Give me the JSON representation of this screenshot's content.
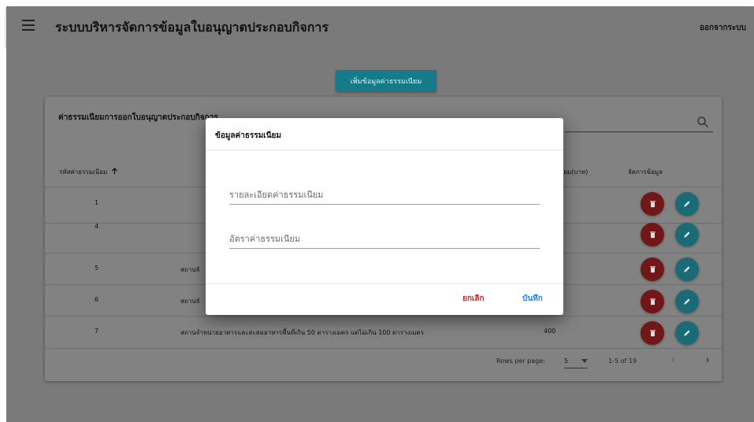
{
  "app": {
    "title": "ระบบบริหารจัดการข้อมูลใบอนุญาตประกอบกิจการ",
    "logout_label": "ออกจากระบบ"
  },
  "toolbar": {
    "add_label": "เพิ่มข้อมูลค่าธรรมเนียม"
  },
  "table": {
    "title": "ค่าธรรมเนียมการออกใบอนุญาตประกอบกิจการ",
    "columns": {
      "code": "รหัสค่าธรรมเนียม",
      "detail": "",
      "rate": "ค่าธรรมเนียม(บาท)",
      "rate_visible": "เนียม(บาท)",
      "actions": "จัดการข้อมูล"
    },
    "rows": [
      {
        "code": "1",
        "detail": "",
        "rate": ""
      },
      {
        "code": "4",
        "detail": "",
        "rate": ""
      },
      {
        "code": "5",
        "detail": "สถานจั",
        "rate": ""
      },
      {
        "code": "6",
        "detail": "สถานจั",
        "rate": ""
      },
      {
        "code": "7",
        "detail": "สถานจำหน่ายอาหารและสะสมอาหารพื้นที่เกิน 50 ตารางเมตร แต่ไม่เกิน 100 ตารางเมตร",
        "rate": "400"
      }
    ],
    "footer": {
      "rows_per_page_label": "Rows per page:",
      "rows_per_page_value": "5",
      "range_label": "1-5 of 19"
    }
  },
  "dialog": {
    "title": "ข้อมูลค่าธรรมเนียม",
    "detail_placeholder": "รายละเอียดค่าธรรมเนียม",
    "rate_placeholder": "อัตราค่าธรรมเนียม",
    "cancel_label": "ยกเลิก",
    "save_label": "บันทึก"
  },
  "colors": {
    "cancel": "#c62828",
    "save": "#1e88e5",
    "delete_button": "#711717",
    "edit_button": "#1a6b76"
  },
  "icons": {
    "menu": "hamburger-menu-icon",
    "search": "search-icon",
    "sort": "arrow-up-icon",
    "delete": "trash-icon",
    "edit": "pencil-icon",
    "dropdown": "caret-down-icon",
    "prev": "chevron-left-icon",
    "next": "chevron-right-icon"
  }
}
